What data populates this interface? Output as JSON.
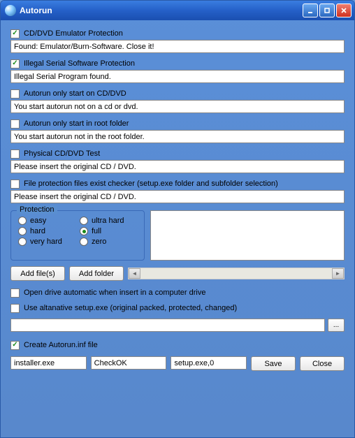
{
  "window": {
    "title": "Autorun"
  },
  "options": {
    "emulator": {
      "label": "CD/DVD Emulator Protection",
      "checked": true,
      "message": "Found: Emulator/Burn-Software. Close it!"
    },
    "serial": {
      "label": "Illegal Serial Software Protection",
      "checked": true,
      "message": "Illegal Serial Program found."
    },
    "cddvd_only": {
      "label": "Autorun only start on CD/DVD",
      "checked": false,
      "message": "You start autorun not on a cd or dvd."
    },
    "root_only": {
      "label": "Autorun only start in root folder",
      "checked": false,
      "message": "You start autorun not in the root folder."
    },
    "physical": {
      "label": "Physical CD/DVD Test",
      "checked": false,
      "message": "Please insert the original CD / DVD."
    },
    "fileprot": {
      "label": "File protection files exist checker (setup.exe folder and subfolder selection)",
      "checked": false,
      "message": "Please insert the original CD / DVD."
    }
  },
  "protection": {
    "legend": "Protection",
    "levels": {
      "easy": "easy",
      "hard": "hard",
      "very_hard": "very hard",
      "ultra_hard": "ultra hard",
      "full": "full",
      "zero": "zero"
    },
    "selected": "full"
  },
  "buttons": {
    "add_files": "Add file(s)",
    "add_folder": "Add folder",
    "save": "Save",
    "close": "Close",
    "browse": "..."
  },
  "lower_options": {
    "open_drive": {
      "label": "Open drive automatic when insert in a computer drive",
      "checked": false
    },
    "alt_setup": {
      "label": "Use altanative setup.exe (original packed, protected, changed)",
      "checked": false
    },
    "alt_path": ""
  },
  "autorun_inf": {
    "label": "Create Autorun.inf file",
    "checked": true,
    "installer": "installer.exe",
    "checkok": "CheckOK",
    "setup": "setup.exe,0"
  }
}
